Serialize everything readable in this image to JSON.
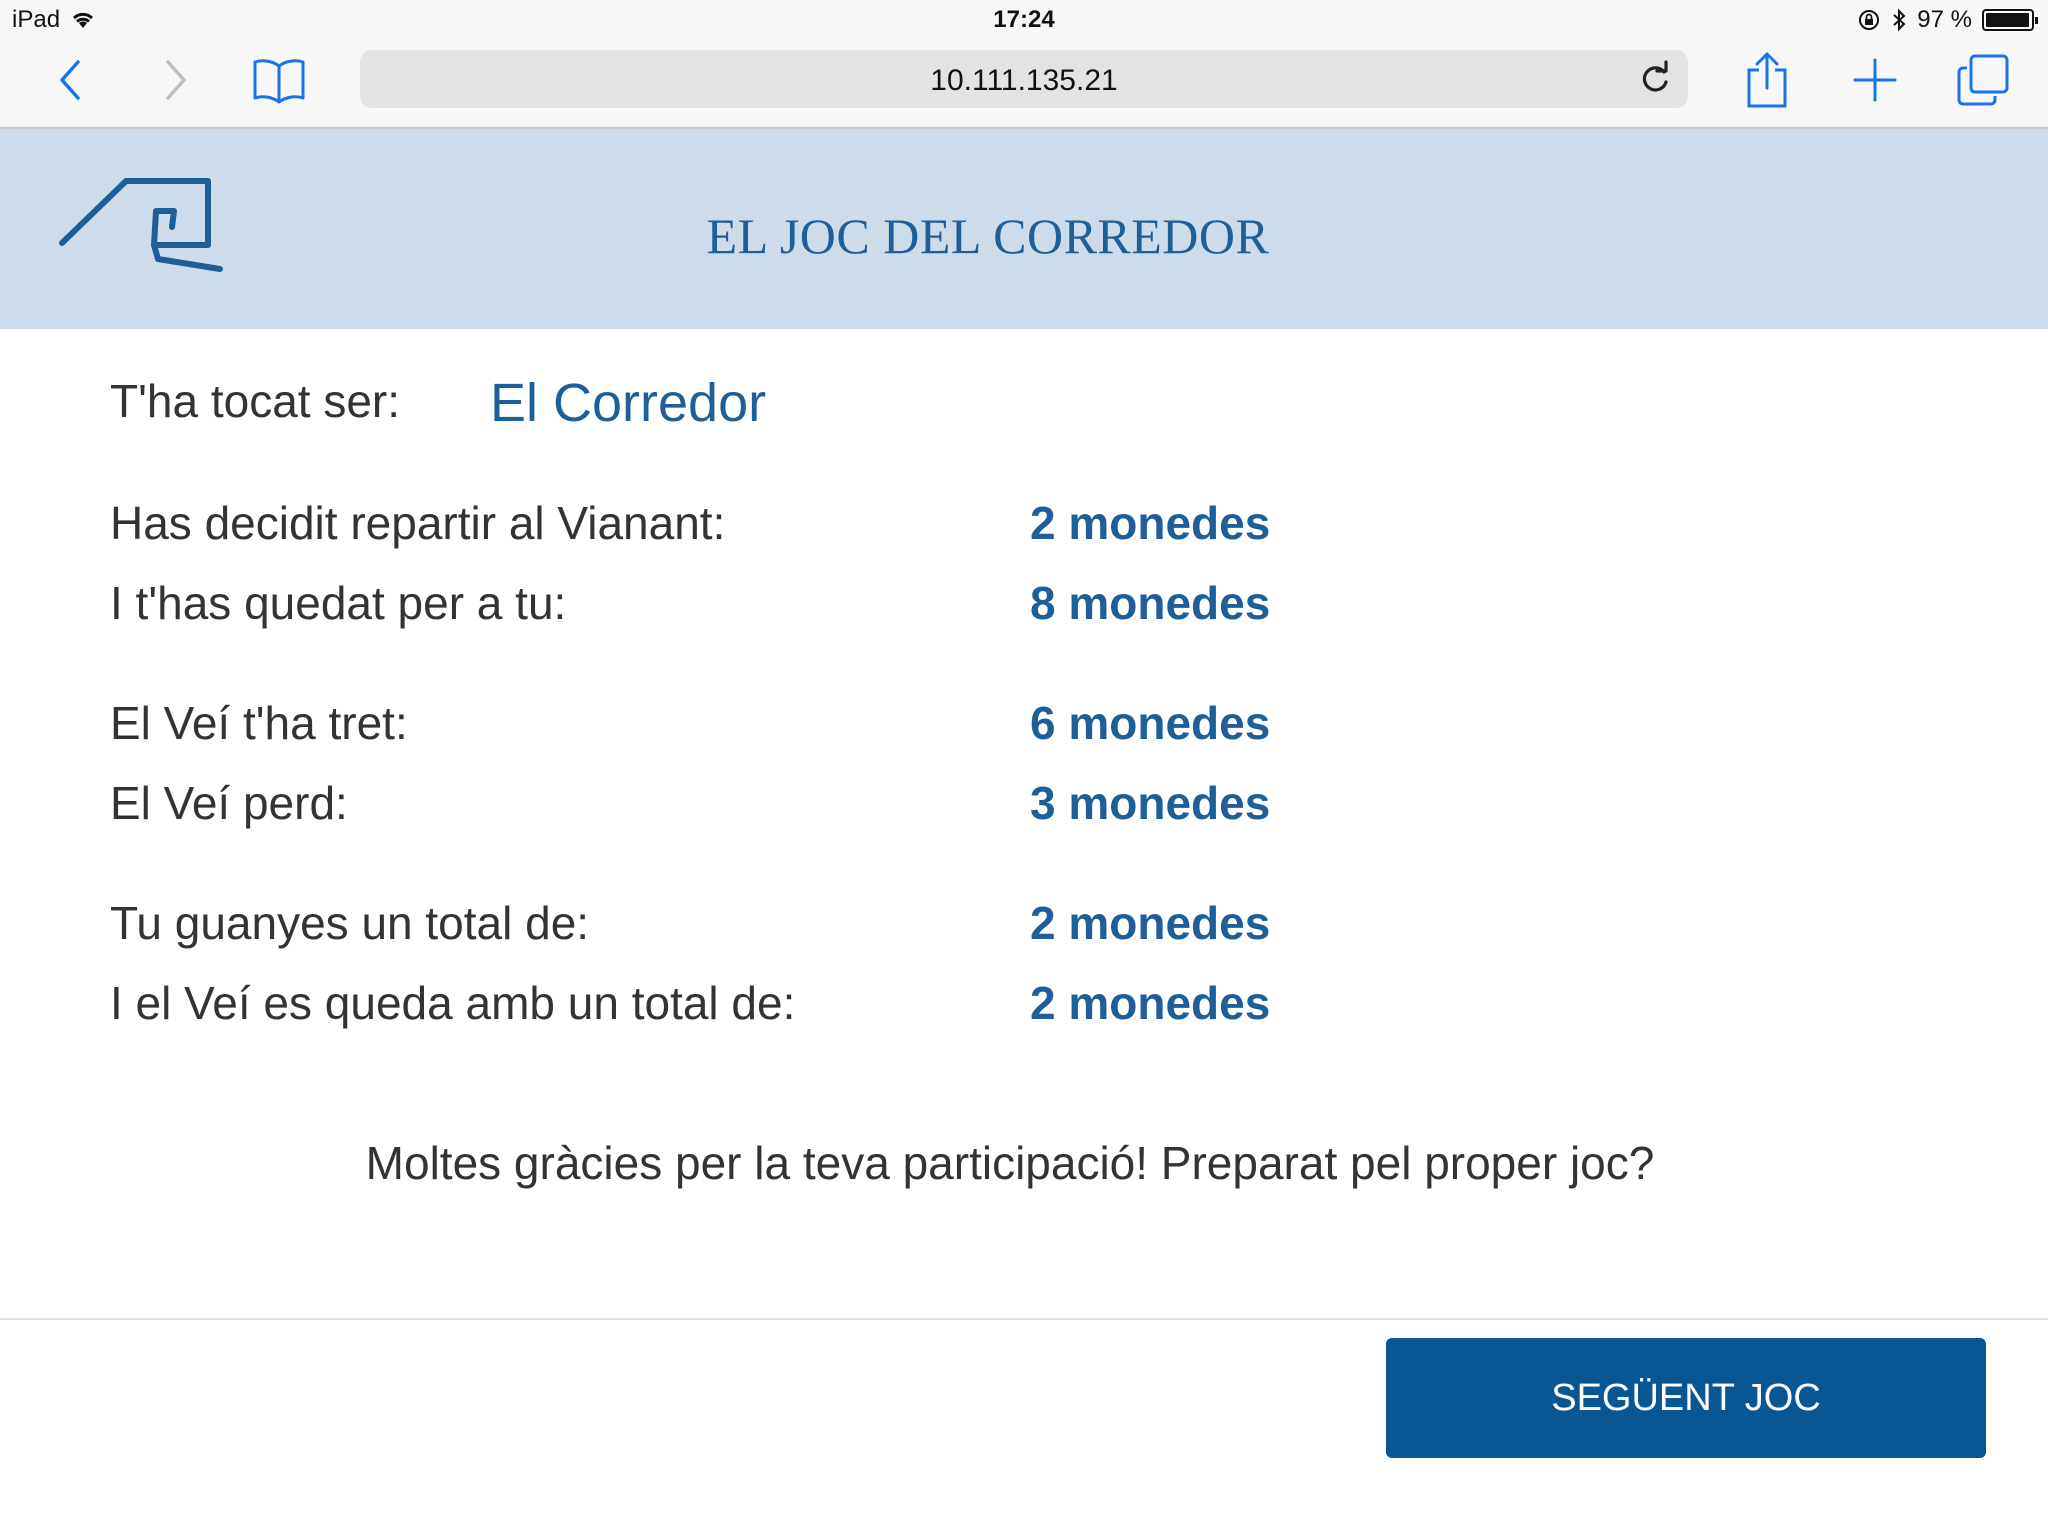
{
  "status_bar": {
    "device": "iPad",
    "time": "17:24",
    "battery_label": "97 %",
    "battery_level": 0.97
  },
  "browser": {
    "url": "10.111.135.21",
    "icons": [
      "back-icon",
      "forward-icon",
      "bookmarks-icon",
      "reload-icon",
      "share-icon",
      "new-tab-icon",
      "tabs-icon"
    ]
  },
  "header": {
    "title": "EL JOC DEL CORREDOR"
  },
  "role": {
    "label": "T'ha tocat ser:",
    "value": "El Corredor"
  },
  "results": [
    {
      "label": "Has decidit repartir al Vianant:",
      "value": "2 monedes"
    },
    {
      "label": "I t'has quedat per a tu:",
      "value": "8 monedes"
    },
    {
      "label": "El Veí t'ha tret:",
      "value": "6 monedes"
    },
    {
      "label": "El Veí perd:",
      "value": "3 monedes"
    },
    {
      "label": "Tu guanyes un total de:",
      "value": "2 monedes"
    },
    {
      "label": "I el Veí es queda amb un total de:",
      "value": "2 monedes"
    }
  ],
  "thanks_message": "Moltes gràcies per la teva participació! Preparat pel proper joc?",
  "next_button_label": "SEGÜENT JOC",
  "colors": {
    "accent": "#1f5f99",
    "button": "#085794",
    "header_bg": "#cddcea"
  }
}
